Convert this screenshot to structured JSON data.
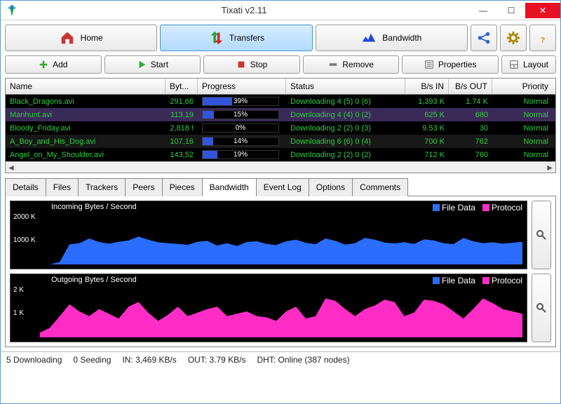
{
  "title": "Tixati v2.11",
  "nav": {
    "home": "Home",
    "transfers": "Transfers",
    "bandwidth": "Bandwidth"
  },
  "toolbar": {
    "add": "Add",
    "start": "Start",
    "stop": "Stop",
    "remove": "Remove",
    "properties": "Properties",
    "layout": "Layout"
  },
  "columns": {
    "name": "Name",
    "bytes": "Byt...",
    "progress": "Progress",
    "status": "Status",
    "bin": "B/s IN",
    "bout": "B/s OUT",
    "priority": "Priority"
  },
  "rows": [
    {
      "name": "Black_Dragons.avi",
      "bytes": "291,66",
      "progress": 39,
      "ptxt": "39%",
      "status": "Downloading 4 (5) 0 (6)",
      "bin": "1,393 K",
      "bout": "1.74 K",
      "prio": "Normal",
      "sel": false,
      "alt": false
    },
    {
      "name": "Manhunt.avi",
      "bytes": "113,19",
      "progress": 15,
      "ptxt": "15%",
      "status": "Downloading 4 (4) 0 (2)",
      "bin": "625 K",
      "bout": "680",
      "prio": "Normal",
      "sel": true,
      "alt": false
    },
    {
      "name": "Bloody_Friday.avi",
      "bytes": "2,818 !",
      "progress": 0,
      "ptxt": "0%",
      "status": "Downloading 2 (2) 0 (3)",
      "bin": "9.53 K",
      "bout": "30",
      "prio": "Normal",
      "sel": false,
      "alt": false
    },
    {
      "name": "A_Boy_and_His_Dog.avi",
      "bytes": "107,16",
      "progress": 14,
      "ptxt": "14%",
      "status": "Downloading 6 (6) 0 (4)",
      "bin": "700 K",
      "bout": "762",
      "prio": "Normal",
      "sel": false,
      "alt": true
    },
    {
      "name": "Angel_on_My_Shoulder.avi",
      "bytes": "143,52",
      "progress": 19,
      "ptxt": "19%",
      "status": "Downloading 2 (2) 0 (2)",
      "bin": "712 K",
      "bout": "760",
      "prio": "Normal",
      "sel": false,
      "alt": false
    }
  ],
  "tabs": [
    "Details",
    "Files",
    "Trackers",
    "Peers",
    "Pieces",
    "Bandwidth",
    "Event Log",
    "Options",
    "Comments"
  ],
  "active_tab": "Bandwidth",
  "chart_data": [
    {
      "type": "area",
      "title": "Incoming Bytes / Second",
      "series": [
        {
          "name": "File Data",
          "color": "#2a6dff"
        },
        {
          "name": "Protocol",
          "color": "#ff2dc6"
        }
      ],
      "ylim": [
        0,
        2200
      ],
      "yticks": [
        {
          "v": 1000,
          "l": "1000 K"
        },
        {
          "v": 2000,
          "l": "2000 K"
        }
      ],
      "values": [
        0,
        0,
        100,
        850,
        900,
        1100,
        950,
        880,
        960,
        1020,
        1180,
        1050,
        940,
        900,
        870,
        830,
        960,
        1000,
        800,
        900,
        780,
        950,
        980,
        870,
        820,
        980,
        1050,
        920,
        860,
        1100,
        1000,
        840,
        900,
        1120,
        1050,
        930,
        890,
        940,
        870,
        1060,
        1020,
        900,
        860,
        1120,
        980,
        900,
        940,
        880,
        920,
        960
      ]
    },
    {
      "type": "area",
      "title": "Outgoing Bytes / Second",
      "series": [
        {
          "name": "File Data",
          "color": "#2a6dff"
        },
        {
          "name": "Protocol",
          "color": "#ff2dc6"
        }
      ],
      "ylim": [
        0,
        2200
      ],
      "yticks": [
        {
          "v": 1000,
          "l": "1 K"
        },
        {
          "v": 2000,
          "l": "2 K"
        }
      ],
      "values": [
        200,
        400,
        900,
        1400,
        1100,
        900,
        1200,
        1000,
        800,
        1300,
        1500,
        1050,
        700,
        950,
        1300,
        900,
        1050,
        1200,
        1300,
        900,
        1000,
        1100,
        900,
        850,
        700,
        1100,
        1300,
        800,
        900,
        1650,
        1550,
        1200,
        900,
        1200,
        1350,
        1600,
        1500,
        900,
        1050,
        1600,
        1550,
        1400,
        1100,
        800,
        1200,
        1650,
        1450,
        1200,
        1100,
        1000
      ]
    }
  ],
  "status": {
    "dl": "5 Downloading",
    "seed": "0 Seeding",
    "in": "IN: 3,469 KB/s",
    "out": "OUT: 3.79 KB/s",
    "dht": "DHT: Online (387 nodes)"
  }
}
